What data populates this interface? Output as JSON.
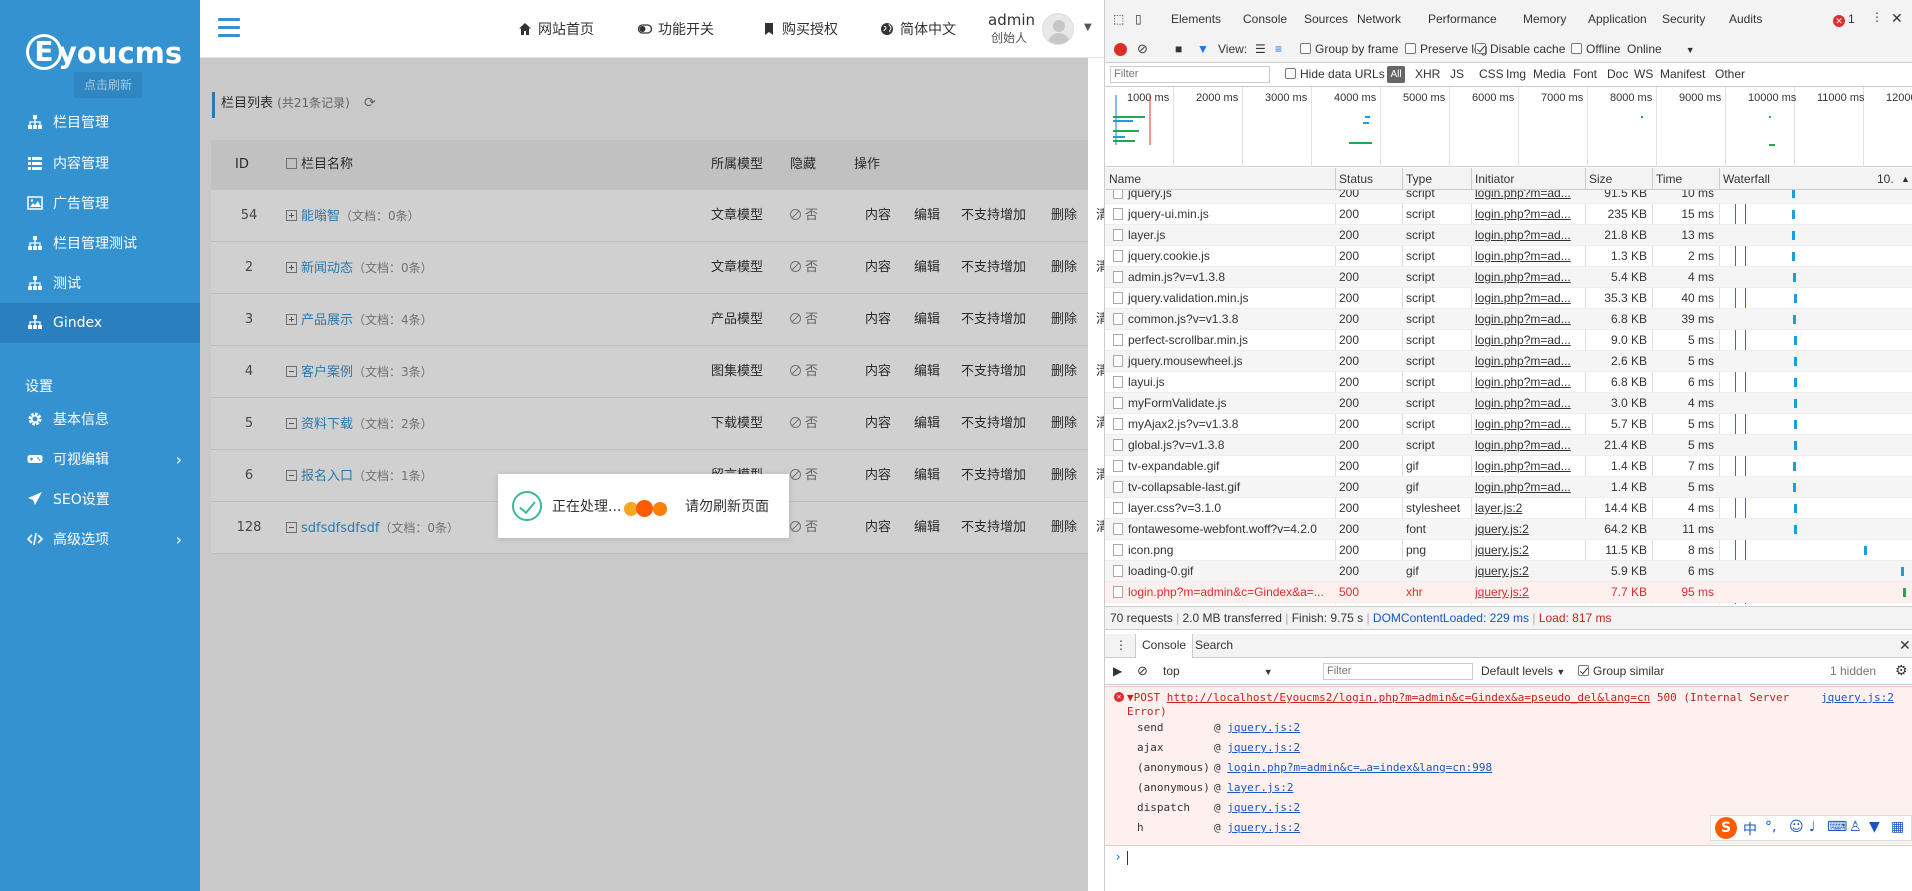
{
  "sidebar": {
    "logo_letter": "E",
    "logo_text": "youcms",
    "refresh_hint": "点击刷新",
    "items": [
      {
        "label": "栏目管理",
        "icon": "sitemap-icon"
      },
      {
        "label": "内容管理",
        "icon": "list-icon"
      },
      {
        "label": "广告管理",
        "icon": "image-icon"
      },
      {
        "label": "栏目管理测试",
        "icon": "sitemap-icon"
      },
      {
        "label": "测试",
        "icon": "sitemap-icon"
      },
      {
        "label": "Gindex",
        "icon": "sitemap-icon",
        "active": true
      }
    ],
    "settings_label": "设置",
    "settings_items": [
      {
        "label": "基本信息",
        "icon": "gear-icon"
      },
      {
        "label": "可视编辑",
        "icon": "gamepad-icon",
        "chevron": true
      },
      {
        "label": "SEO设置",
        "icon": "send-icon"
      },
      {
        "label": "高级选项",
        "icon": "code-icon",
        "chevron": true
      }
    ]
  },
  "topbar": {
    "links": [
      {
        "label": "网站首页",
        "icon": "home-icon"
      },
      {
        "label": "功能开关",
        "icon": "toggle-icon"
      },
      {
        "label": "购买授权",
        "icon": "bookmark-icon"
      },
      {
        "label": "简体中文",
        "icon": "globe-icon"
      }
    ],
    "admin_name": "admin",
    "admin_role": "创始人"
  },
  "list": {
    "title": "栏目列表",
    "count": "(共21条记录)",
    "columns": [
      "ID",
      "栏目名称",
      "所属模型",
      "隐藏",
      "操作"
    ],
    "rows": [
      {
        "id": "54",
        "toggle": "plus",
        "name": "能嗡智",
        "docs": "（文档：0条）",
        "model": "文章模型",
        "hidden": "否"
      },
      {
        "id": "2",
        "toggle": "plus",
        "name": "新闻动态",
        "docs": "（文档：0条）",
        "model": "文章模型",
        "hidden": "否"
      },
      {
        "id": "3",
        "toggle": "plus",
        "name": "产品展示",
        "docs": "（文档：4条）",
        "model": "产品模型",
        "hidden": "否"
      },
      {
        "id": "4",
        "toggle": "minus",
        "name": "客户案例",
        "docs": "（文档：3条）",
        "model": "图集模型",
        "hidden": "否"
      },
      {
        "id": "5",
        "toggle": "minus",
        "name": "资料下载",
        "docs": "（文档：2条）",
        "model": "下载模型",
        "hidden": "否"
      },
      {
        "id": "6",
        "toggle": "minus",
        "name": "报名入口",
        "docs": "（文档：1条）",
        "model": "留言模型",
        "hidden": "否"
      },
      {
        "id": "128",
        "toggle": "minus",
        "name": "sdfsdfsdfsdf",
        "docs": "（文档：0条）",
        "model": "",
        "hidden": "否"
      }
    ],
    "ops": [
      "内容",
      "编辑",
      "不支持增加",
      "删除",
      "清"
    ]
  },
  "processing": {
    "message": "正在处理...",
    "hint": "请勿刷新页面",
    "dot_colors": [
      "#f5a623",
      "#ff5a00",
      "#ff7f00"
    ]
  },
  "devtools": {
    "tabs": [
      "Elements",
      "Console",
      "Sources",
      "Network",
      "Performance",
      "Memory",
      "Application",
      "Security",
      "Audits"
    ],
    "active_tab": "Network",
    "error_count": "1",
    "toolbar": {
      "view_label": "View:",
      "group_by_frame": "Group by frame",
      "preserve_log": "Preserve log",
      "disable_cache": "Disable cache",
      "offline": "Offline",
      "throttle": "Online"
    },
    "filter": {
      "placeholder": "Filter",
      "hide_data_urls": "Hide data URLs",
      "all": "All",
      "types": [
        "XHR",
        "JS",
        "CSS",
        "Img",
        "Media",
        "Font",
        "Doc",
        "WS",
        "Manifest",
        "Other"
      ]
    },
    "overview_ticks": [
      "1000 ms",
      "2000 ms",
      "3000 ms",
      "4000 ms",
      "5000 ms",
      "6000 ms",
      "7000 ms",
      "8000 ms",
      "9000 ms",
      "10000 ms",
      "11000 ms",
      "12000"
    ],
    "columns": [
      "Name",
      "Status",
      "Type",
      "Initiator",
      "Size",
      "Time",
      "Waterfall",
      "10."
    ],
    "requests": [
      {
        "name": "jquery.js",
        "status": "200",
        "type": "script",
        "initiator": "login.php?m=ad...",
        "size": "91.5 KB",
        "time": "10 ms"
      },
      {
        "name": "jquery-ui.min.js",
        "status": "200",
        "type": "script",
        "initiator": "login.php?m=ad...",
        "size": "235 KB",
        "time": "15 ms"
      },
      {
        "name": "layer.js",
        "status": "200",
        "type": "script",
        "initiator": "login.php?m=ad...",
        "size": "21.8 KB",
        "time": "13 ms"
      },
      {
        "name": "jquery.cookie.js",
        "status": "200",
        "type": "script",
        "initiator": "login.php?m=ad...",
        "size": "1.3 KB",
        "time": "2 ms"
      },
      {
        "name": "admin.js?v=v1.3.8",
        "status": "200",
        "type": "script",
        "initiator": "login.php?m=ad...",
        "size": "5.4 KB",
        "time": "4 ms"
      },
      {
        "name": "jquery.validation.min.js",
        "status": "200",
        "type": "script",
        "initiator": "login.php?m=ad...",
        "size": "35.3 KB",
        "time": "40 ms"
      },
      {
        "name": "common.js?v=v1.3.8",
        "status": "200",
        "type": "script",
        "initiator": "login.php?m=ad...",
        "size": "6.8 KB",
        "time": "39 ms"
      },
      {
        "name": "perfect-scrollbar.min.js",
        "status": "200",
        "type": "script",
        "initiator": "login.php?m=ad...",
        "size": "9.0 KB",
        "time": "5 ms"
      },
      {
        "name": "jquery.mousewheel.js",
        "status": "200",
        "type": "script",
        "initiator": "login.php?m=ad...",
        "size": "2.6 KB",
        "time": "5 ms"
      },
      {
        "name": "layui.js",
        "status": "200",
        "type": "script",
        "initiator": "login.php?m=ad...",
        "size": "6.8 KB",
        "time": "6 ms"
      },
      {
        "name": "myFormValidate.js",
        "status": "200",
        "type": "script",
        "initiator": "login.php?m=ad...",
        "size": "3.0 KB",
        "time": "4 ms"
      },
      {
        "name": "myAjax2.js?v=v1.3.8",
        "status": "200",
        "type": "script",
        "initiator": "login.php?m=ad...",
        "size": "5.7 KB",
        "time": "5 ms"
      },
      {
        "name": "global.js?v=v1.3.8",
        "status": "200",
        "type": "script",
        "initiator": "login.php?m=ad...",
        "size": "21.4 KB",
        "time": "5 ms"
      },
      {
        "name": "tv-expandable.gif",
        "status": "200",
        "type": "gif",
        "initiator": "login.php?m=ad...",
        "size": "1.4 KB",
        "time": "7 ms"
      },
      {
        "name": "tv-collapsable-last.gif",
        "status": "200",
        "type": "gif",
        "initiator": "login.php?m=ad...",
        "size": "1.4 KB",
        "time": "5 ms"
      },
      {
        "name": "layer.css?v=3.1.0",
        "status": "200",
        "type": "stylesheet",
        "initiator": "layer.js:2",
        "size": "14.4 KB",
        "time": "4 ms"
      },
      {
        "name": "fontawesome-webfont.woff?v=4.2.0",
        "status": "200",
        "type": "font",
        "initiator": "jquery.js:2",
        "size": "64.2 KB",
        "time": "11 ms"
      },
      {
        "name": "icon.png",
        "status": "200",
        "type": "png",
        "initiator": "jquery.js:2",
        "size": "11.5 KB",
        "time": "8 ms"
      },
      {
        "name": "loading-0.gif",
        "status": "200",
        "type": "gif",
        "initiator": "jquery.js:2",
        "size": "5.9 KB",
        "time": "6 ms"
      },
      {
        "name": "login.php?m=admin&c=Gindex&a=...",
        "status": "500",
        "type": "xhr",
        "initiator": "jquery.js:2",
        "size": "7.7 KB",
        "time": "95 ms",
        "error": true
      }
    ],
    "summary": {
      "requests": "70 requests",
      "transferred": "2.0 MB transferred",
      "finish": "Finish: 9.75 s",
      "dom": "DOMContentLoaded: 229 ms",
      "load": "Load: 817 ms"
    },
    "drawer_tabs": [
      "Console",
      "Search"
    ],
    "console": {
      "context": "top",
      "filter_placeholder": "Filter",
      "levels": "Default levels",
      "group_similar": "Group similar",
      "hidden": "1 hidden",
      "error_method": "POST",
      "error_url": "http://localhost/Eyoucms2/login.php?m=admin&c=Gindex&a=pseudo_del&lang=cn",
      "error_status": "500 (Internal Server",
      "error_status2": "Error)",
      "error_source": "jquery.js:2",
      "stack": [
        {
          "fn": "send",
          "src": "jquery.js:2"
        },
        {
          "fn": "ajax",
          "src": "jquery.js:2"
        },
        {
          "fn": "(anonymous)",
          "src": "login.php?m=admin&c=…a=index&lang=cn:998"
        },
        {
          "fn": "(anonymous)",
          "src": "layer.js:2"
        },
        {
          "fn": "dispatch",
          "src": "jquery.js:2"
        },
        {
          "fn": "h",
          "src": "jquery.js:2"
        }
      ]
    },
    "prompt": "›"
  },
  "ime": {
    "label": "S",
    "mode": "中"
  },
  "colors": {
    "sidebar_bg": "#3592d1",
    "sidebar_active": "#2a7fbf",
    "error_red": "#e02c2c",
    "link_blue": "#1a55c0"
  }
}
